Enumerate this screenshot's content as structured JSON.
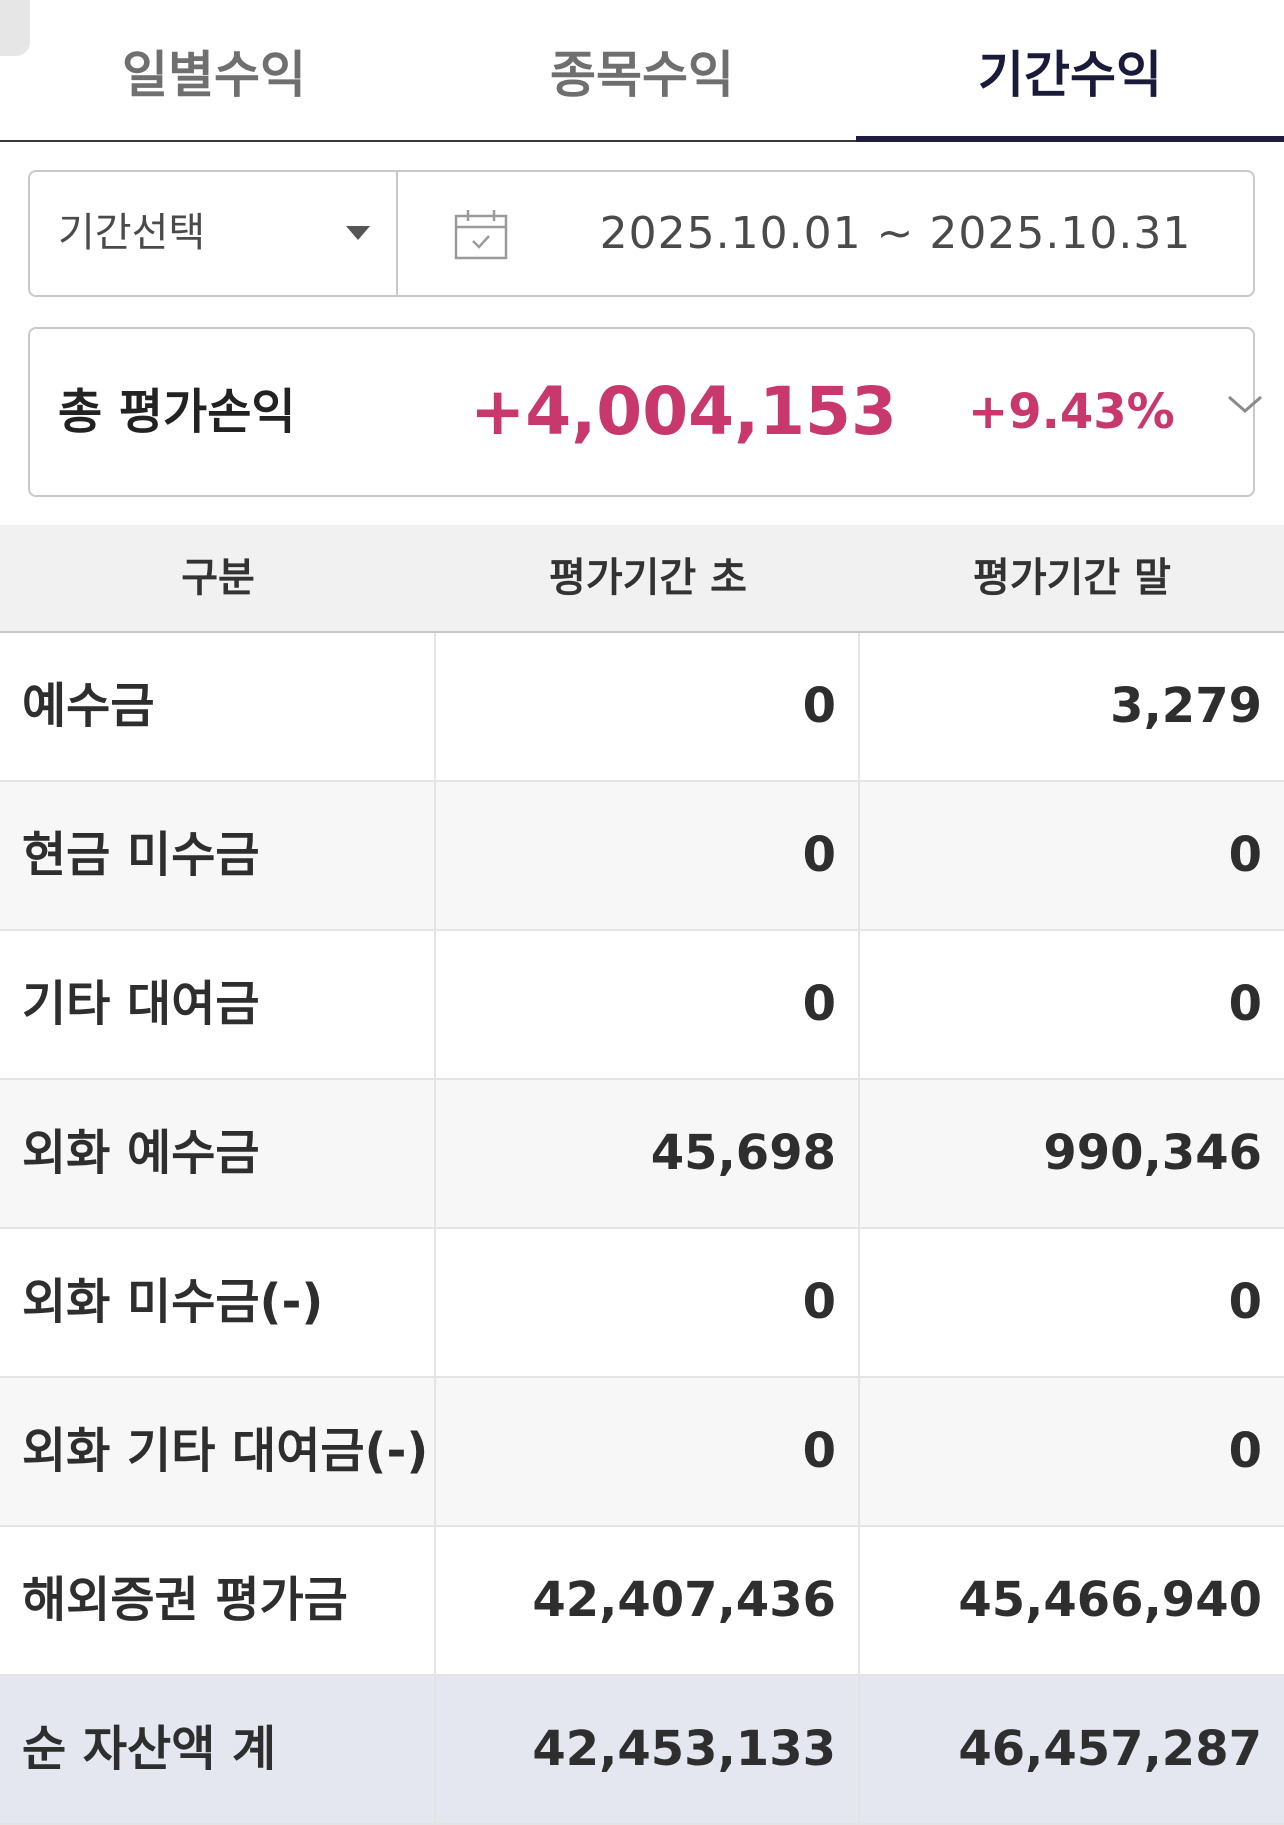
{
  "tabs": [
    {
      "label": "일별수익"
    },
    {
      "label": "종목수익"
    },
    {
      "label": "기간수익"
    }
  ],
  "active_tab": "기간수익",
  "filter": {
    "period_select_label": "기간선택",
    "date_range": "2025.10.01 ~ 2025.10.31"
  },
  "summary": {
    "title": "총 평가손익",
    "amount": "+4,004,153",
    "percent": "+9.43%"
  },
  "colors": {
    "positive": "#c8386c",
    "active_tab": "#1c1c3c"
  },
  "table": {
    "headers": [
      "구분",
      "평가기간 초",
      "평가기간 말"
    ],
    "rows": [
      {
        "label": "예수금",
        "start": "0",
        "end": "3,279"
      },
      {
        "label": "현금 미수금",
        "start": "0",
        "end": "0"
      },
      {
        "label": "기타 대여금",
        "start": "0",
        "end": "0"
      },
      {
        "label": "외화 예수금",
        "start": "45,698",
        "end": "990,346"
      },
      {
        "label": "외화 미수금(-)",
        "start": "0",
        "end": "0"
      },
      {
        "label": "외화 기타 대여금(-)",
        "start": "0",
        "end": "0"
      },
      {
        "label": "해외증권 평가금",
        "start": "42,407,436",
        "end": "45,466,940"
      },
      {
        "label": "순 자산액 계",
        "start": "42,453,133",
        "end": "46,457,287"
      }
    ]
  }
}
